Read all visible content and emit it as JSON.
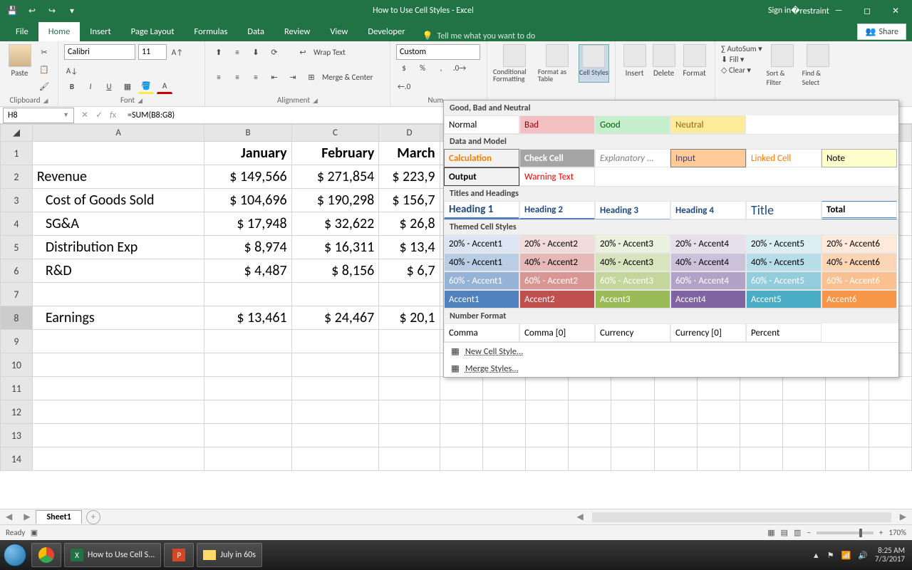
{
  "titlebar": {
    "title": "How to Use Cell Styles - Excel",
    "signin": "Sign in"
  },
  "tabs": {
    "file": "File",
    "home": "Home",
    "insert": "Insert",
    "pagelayout": "Page Layout",
    "formulas": "Formulas",
    "data": "Data",
    "review": "Review",
    "view": "View",
    "developer": "Developer",
    "tellme": "Tell me what you want to do",
    "share": "Share"
  },
  "ribbon": {
    "clipboard": {
      "paste": "Paste",
      "label": "Clipboard"
    },
    "font": {
      "name": "Calibri",
      "size": "11",
      "label": "Font"
    },
    "alignment": {
      "wrap": "Wrap Text",
      "merge": "Merge & Center",
      "label": "Alignment"
    },
    "number": {
      "format": "Custom",
      "label": "Num..."
    },
    "styles": {
      "cond": "Conditional Formatting",
      "table": "Format as Table",
      "cell": "Cell Styles"
    },
    "cells": {
      "insert": "Insert",
      "delete": "Delete",
      "format": "Format"
    },
    "editing": {
      "autosum": "AutoSum",
      "fill": "Fill",
      "clear": "Clear",
      "sort": "Sort & Filter",
      "find": "Find & Select"
    }
  },
  "formula": {
    "namebox": "H8",
    "formula": "=SUM(B8:G8)"
  },
  "columns": [
    "A",
    "B",
    "C",
    "D"
  ],
  "rows": [
    {
      "n": 1,
      "A": "",
      "B": "January",
      "C": "February",
      "D": "March",
      "bold": true
    },
    {
      "n": 2,
      "A": "Revenue",
      "B": "$ 149,566",
      "C": "$ 271,854",
      "D": "$ 223,9"
    },
    {
      "n": 3,
      "A": "Cost of Goods Sold",
      "B": "$ 104,696",
      "C": "$ 190,298",
      "D": "$ 156,7",
      "indent": true
    },
    {
      "n": 4,
      "A": "SG&A",
      "B": "$   17,948",
      "C": "$   32,622",
      "D": "$   26,8",
      "indent": true
    },
    {
      "n": 5,
      "A": "Distribution Exp",
      "B": "$     8,974",
      "C": "$   16,311",
      "D": "$   13,4",
      "indent": true
    },
    {
      "n": 6,
      "A": "R&D",
      "B": "$     4,487",
      "C": "$     8,156",
      "D": "$     6,7",
      "indent": true
    },
    {
      "n": 7,
      "A": "",
      "B": "",
      "C": "",
      "D": ""
    },
    {
      "n": 8,
      "A": "Earnings",
      "B": "$   13,461",
      "C": "$   24,467",
      "D": "$   20,1",
      "indent": true
    },
    {
      "n": 9
    },
    {
      "n": 10
    },
    {
      "n": 11
    },
    {
      "n": 12
    },
    {
      "n": 13
    },
    {
      "n": 14
    }
  ],
  "styles_popup": {
    "sec1": "Good, Bad and Neutral",
    "normal": "Normal",
    "bad": "Bad",
    "good": "Good",
    "neutral": "Neutral",
    "sec2": "Data and Model",
    "calc": "Calculation",
    "check": "Check Cell",
    "explan": "Explanatory ...",
    "input": "Input",
    "linked": "Linked Cell",
    "note": "Note",
    "output": "Output",
    "warn": "Warning Text",
    "sec3": "Titles and Headings",
    "h1": "Heading 1",
    "h2": "Heading 2",
    "h3": "Heading 3",
    "h4": "Heading 4",
    "title": "Title",
    "total": "Total",
    "sec4": "Themed Cell Styles",
    "a20": [
      "20% - Accent1",
      "20% - Accent2",
      "20% - Accent3",
      "20% - Accent4",
      "20% - Accent5",
      "20% - Accent6"
    ],
    "a40": [
      "40% - Accent1",
      "40% - Accent2",
      "40% - Accent3",
      "40% - Accent4",
      "40% - Accent5",
      "40% - Accent6"
    ],
    "a60": [
      "60% - Accent1",
      "60% - Accent2",
      "60% - Accent3",
      "60% - Accent4",
      "60% - Accent5",
      "60% - Accent6"
    ],
    "acc": [
      "Accent1",
      "Accent2",
      "Accent3",
      "Accent4",
      "Accent5",
      "Accent6"
    ],
    "sec5": "Number Format",
    "nf": [
      "Comma",
      "Comma [0]",
      "Currency",
      "Currency [0]",
      "Percent"
    ],
    "new": "New Cell Style...",
    "merge": "Merge Styles..."
  },
  "sheet": {
    "name": "Sheet1"
  },
  "status": {
    "ready": "Ready",
    "zoom": "170%"
  },
  "taskbar": {
    "excel": "How to Use Cell S...",
    "pp": "P",
    "folder": "July in 60s",
    "time": "8:25 AM",
    "date": "7/3/2017"
  }
}
